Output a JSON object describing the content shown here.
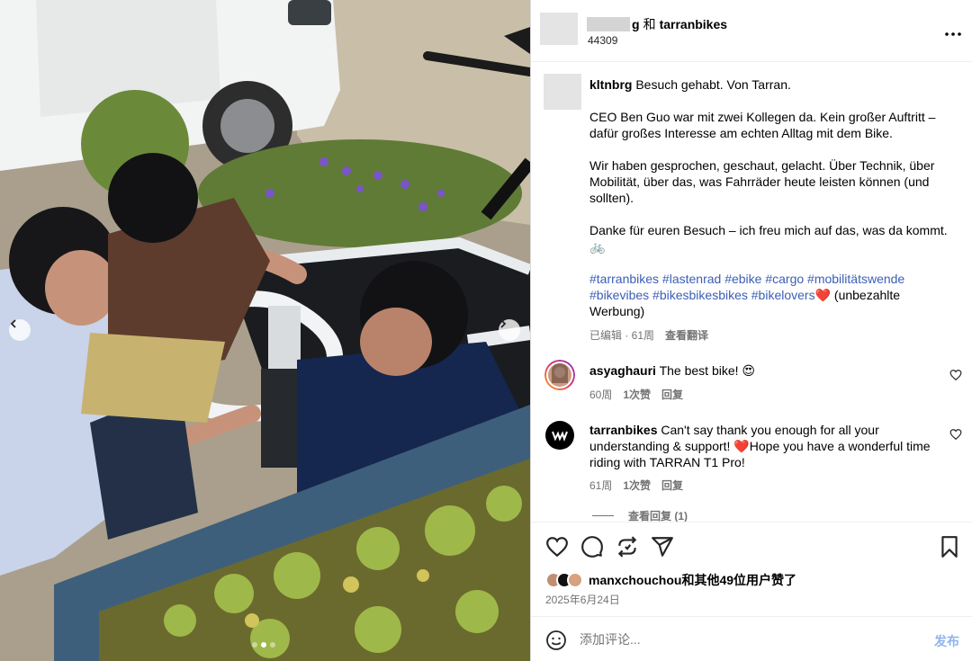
{
  "post": {
    "header": {
      "partner": "tarranbikes",
      "joiner": "和",
      "subtitle": "44309",
      "more_icon": "more-horizontal-icon"
    },
    "caption": {
      "user": "kltnbrg",
      "lead": "Besuch gehabt. Von Tarran.",
      "p1": "CEO Ben Guo war mit zwei Kollegen da. Kein großer Auftritt – dafür großes Interesse am echten Alltag mit dem Bike.",
      "p2": "Wir haben gesprochen, geschaut, gelacht. Über Technik, über Mobilität, über das, was Fahrräder heute leisten können (und sollten).",
      "p3": "Danke für euren Besuch – ich freu mich auf das, was da kommt. 🚲",
      "hashtags1": "#tarranbikes #lastenrad #ebike #cargo #mobilitätswende",
      "hashtags2": "#bikevibes #bikesbikesbikes #bikelovers",
      "hashtag_heart": "❤️",
      "tail": " (unbezahlte Werbung)",
      "meta_edited": "已编辑 · 61周",
      "meta_translate": "查看翻译"
    },
    "comments": [
      {
        "user": "asyaghauri",
        "text": "The best bike! 😍",
        "time": "60周",
        "likes": "1次赞",
        "reply": "回复"
      },
      {
        "user": "tarranbikes",
        "text": "Can't say thank you enough for all your understanding & support! ❤️Hope you have a wonderful time riding with TARRAN T1 Pro!",
        "time": "61周",
        "likes": "1次赞",
        "reply": "回复",
        "view_replies": "查看回复 (1)"
      }
    ],
    "actions": {
      "likes_text": "manxchouchou和其他49位用户赞了",
      "date": "2025年6月24日"
    },
    "add_comment": {
      "placeholder": "添加评论...",
      "post_label": "发布"
    },
    "carousel": {
      "slides": 3,
      "current": 2
    },
    "colors": {
      "hashtag": "#3b5eb6",
      "meta": "#737373",
      "post_button": "#8fb3ee",
      "heart": "#ed4956"
    }
  }
}
